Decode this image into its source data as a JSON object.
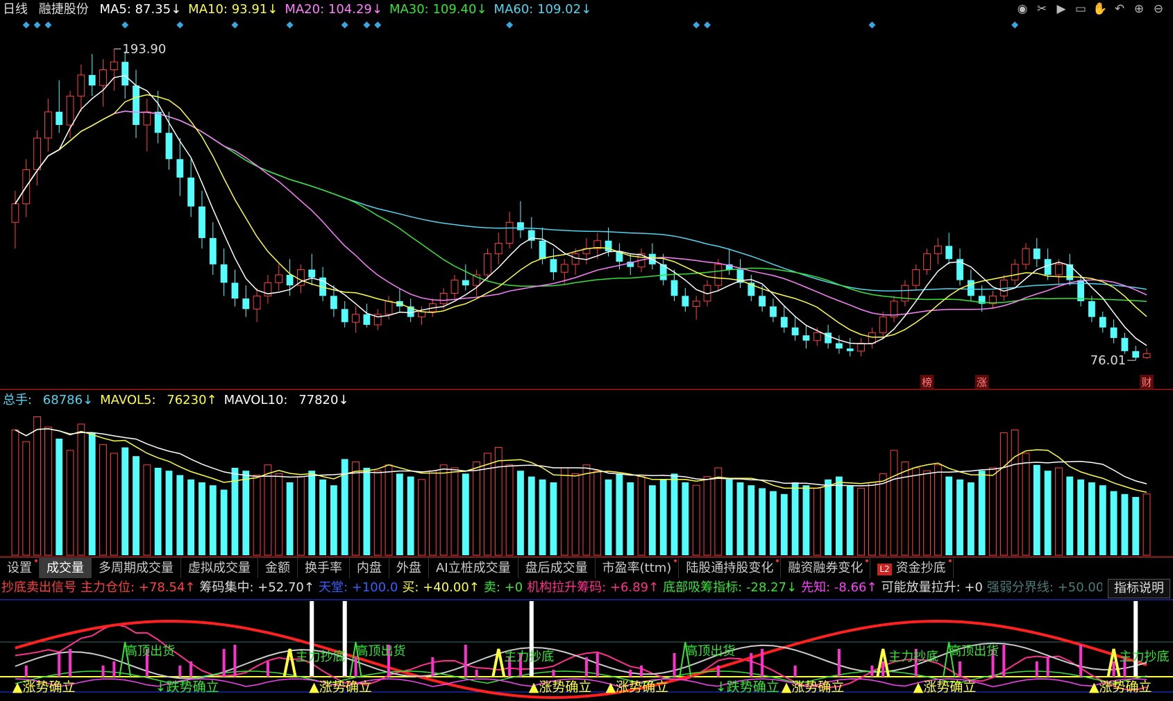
{
  "header": {
    "period": "日线",
    "stock": "融捷股份",
    "ma": [
      {
        "label": "MA5",
        "value": "87.35",
        "arrow": "↓",
        "color": "#ffffff"
      },
      {
        "label": "MA10",
        "value": "93.91",
        "arrow": "↓",
        "color": "#ffff3c"
      },
      {
        "label": "MA20",
        "value": "104.29",
        "arrow": "↓",
        "color": "#ff7fff"
      },
      {
        "label": "MA30",
        "value": "109.40",
        "arrow": "↓",
        "color": "#34e534"
      },
      {
        "label": "MA60",
        "value": "109.02",
        "arrow": "↓",
        "color": "#4fd6f0"
      }
    ]
  },
  "toolbar_icons": [
    "eye-icon",
    "scissors-icon",
    "play-icon",
    "lock-icon",
    "hand-icon",
    "undo-icon",
    "zoom-in-icon",
    "zoom-out-icon"
  ],
  "price_panel": {
    "high_label": "193.90",
    "low_label": "76.01",
    "markers": [
      "榜",
      "涨",
      "财"
    ]
  },
  "volume_header": [
    {
      "label": "总手",
      "value": "68786",
      "arrow": "↓",
      "color": "#4fd6f0"
    },
    {
      "label": "MAVOL5",
      "value": "76230",
      "arrow": "↑",
      "color": "#ffff3c"
    },
    {
      "label": "MAVOL10",
      "value": "77820",
      "arrow": "↓",
      "color": "#ffffff"
    }
  ],
  "tabs": [
    {
      "label": "设置",
      "dot": true
    },
    {
      "label": "成交量",
      "active": true
    },
    {
      "label": "多周期成交量"
    },
    {
      "label": "虚拟成交量"
    },
    {
      "label": "金额"
    },
    {
      "label": "换手率"
    },
    {
      "label": "内盘"
    },
    {
      "label": "外盘"
    },
    {
      "label": "AI立桩成交量"
    },
    {
      "label": "盘后成交量"
    },
    {
      "label": "市盈率(ttm)",
      "dot": true
    },
    {
      "label": "陆股通持股变化",
      "dot": true
    },
    {
      "label": "融资融券变化",
      "dot": true
    },
    {
      "label": "资金抄底",
      "l2": "L2",
      "dot": true
    }
  ],
  "indicator_header": [
    {
      "text": "抄底卖出信号",
      "color": "#ff4040"
    },
    {
      "text": "主力仓位:",
      "value": "+78.54",
      "arrow": "↑",
      "color": "#ff4040"
    },
    {
      "text": "筹码集中:",
      "value": "+52.70",
      "arrow": "↑",
      "color": "#dddddd"
    },
    {
      "text": "天堂:",
      "value": "+100.0",
      "color": "#3060ff"
    },
    {
      "text": "买:",
      "value": "+40.00",
      "arrow": "↑",
      "color": "#ffff3c"
    },
    {
      "text": "卖:",
      "value": "+0",
      "color": "#34e534"
    },
    {
      "text": "机构拉升筹码:",
      "value": "+6.89",
      "arrow": "↑",
      "color": "#ff3090"
    },
    {
      "text": "底部吸筹指标:",
      "value": "-28.27",
      "arrow": "↓",
      "color": "#34e534"
    },
    {
      "text": "先知:",
      "value": "-8.66",
      "arrow": "↑",
      "color": "#ff40ff"
    },
    {
      "text": "可能放量拉升:",
      "value": "+0",
      "color": "#dddddd"
    },
    {
      "text": "强弱分界线:",
      "value": "+50.00",
      "color": "#4a7a7a"
    }
  ],
  "indicator_button": "指标说明",
  "indicator_labels": {
    "top": "高顶出货",
    "bottom": "主力抄底",
    "up": "▲涨势确立",
    "down": "↓跌势确立"
  },
  "chart_data": {
    "type": "candlestick",
    "colors": {
      "up": "#ff4040",
      "down": "#54fcfc",
      "ma5": "#ffffff",
      "ma10": "#ffff3c",
      "ma20": "#ff7fff",
      "ma30": "#34e534",
      "ma60": "#4fd6f0"
    },
    "ohlc": [
      [
        128,
        140,
        118,
        135
      ],
      [
        135,
        152,
        130,
        148
      ],
      [
        148,
        163,
        142,
        160
      ],
      [
        160,
        175,
        155,
        170
      ],
      [
        170,
        182,
        162,
        165
      ],
      [
        165,
        178,
        160,
        176
      ],
      [
        176,
        188,
        170,
        184
      ],
      [
        184,
        192,
        176,
        180
      ],
      [
        180,
        190,
        172,
        186
      ],
      [
        186,
        193.9,
        178,
        189
      ],
      [
        189,
        193,
        175,
        180
      ],
      [
        180,
        186,
        160,
        165
      ],
      [
        165,
        175,
        155,
        170
      ],
      [
        170,
        178,
        158,
        162
      ],
      [
        162,
        170,
        148,
        152
      ],
      [
        152,
        160,
        138,
        145
      ],
      [
        145,
        152,
        130,
        134
      ],
      [
        134,
        140,
        118,
        122
      ],
      [
        122,
        128,
        108,
        112
      ],
      [
        112,
        118,
        100,
        105
      ],
      [
        105,
        110,
        96,
        99
      ],
      [
        99,
        104,
        92,
        95
      ],
      [
        95,
        103,
        90,
        100
      ],
      [
        100,
        108,
        97,
        105
      ],
      [
        105,
        112,
        102,
        108
      ],
      [
        108,
        114,
        100,
        104
      ],
      [
        104,
        112,
        101,
        110
      ],
      [
        110,
        116,
        104,
        107
      ],
      [
        107,
        111,
        98,
        100
      ],
      [
        100,
        104,
        92,
        95
      ],
      [
        95,
        98,
        88,
        90
      ],
      [
        90,
        96,
        86,
        93
      ],
      [
        93,
        97,
        88,
        89
      ],
      [
        89,
        95,
        87,
        93
      ],
      [
        93,
        100,
        91,
        98
      ],
      [
        98,
        103,
        94,
        96
      ],
      [
        96,
        99,
        90,
        92
      ],
      [
        92,
        96,
        89,
        94
      ],
      [
        94,
        99,
        92,
        97
      ],
      [
        97,
        103,
        95,
        101
      ],
      [
        101,
        108,
        99,
        106
      ],
      [
        106,
        112,
        102,
        104
      ],
      [
        104,
        110,
        100,
        108
      ],
      [
        108,
        118,
        106,
        116
      ],
      [
        116,
        124,
        112,
        120
      ],
      [
        120,
        132,
        118,
        128
      ],
      [
        128,
        136,
        122,
        125
      ],
      [
        125,
        130,
        118,
        121
      ],
      [
        121,
        126,
        112,
        114
      ],
      [
        114,
        118,
        106,
        109
      ],
      [
        109,
        114,
        104,
        112
      ],
      [
        112,
        118,
        108,
        116
      ],
      [
        116,
        122,
        112,
        118
      ],
      [
        118,
        124,
        114,
        121
      ],
      [
        121,
        126,
        115,
        117
      ],
      [
        117,
        120,
        110,
        113
      ],
      [
        113,
        116,
        108,
        111
      ],
      [
        111,
        118,
        109,
        116
      ],
      [
        116,
        120,
        110,
        112
      ],
      [
        112,
        116,
        104,
        106
      ],
      [
        106,
        110,
        98,
        100
      ],
      [
        100,
        103,
        94,
        96
      ],
      [
        96,
        100,
        91,
        98
      ],
      [
        98,
        106,
        96,
        104
      ],
      [
        104,
        114,
        102,
        112
      ],
      [
        112,
        118,
        108,
        110
      ],
      [
        110,
        114,
        103,
        105
      ],
      [
        105,
        108,
        98,
        100
      ],
      [
        100,
        104,
        94,
        96
      ],
      [
        96,
        99,
        90,
        92
      ],
      [
        92,
        96,
        86,
        88
      ],
      [
        88,
        92,
        83,
        85
      ],
      [
        85,
        89,
        80,
        83
      ],
      [
        83,
        88,
        81,
        86
      ],
      [
        86,
        89,
        80,
        82
      ],
      [
        82,
        85,
        78,
        80
      ],
      [
        80,
        84,
        77,
        79
      ],
      [
        79,
        84,
        77,
        82
      ],
      [
        82,
        88,
        80,
        86
      ],
      [
        86,
        94,
        84,
        92
      ],
      [
        92,
        100,
        90,
        98
      ],
      [
        98,
        106,
        96,
        104
      ],
      [
        104,
        112,
        102,
        110
      ],
      [
        110,
        118,
        108,
        116
      ],
      [
        116,
        122,
        112,
        119
      ],
      [
        119,
        124,
        112,
        114
      ],
      [
        114,
        118,
        104,
        106
      ],
      [
        106,
        110,
        98,
        100
      ],
      [
        100,
        104,
        94,
        97
      ],
      [
        97,
        102,
        95,
        100
      ],
      [
        100,
        108,
        98,
        106
      ],
      [
        106,
        114,
        104,
        112
      ],
      [
        112,
        120,
        110,
        118
      ],
      [
        118,
        122,
        111,
        114
      ],
      [
        114,
        118,
        106,
        108
      ],
      [
        108,
        114,
        104,
        112
      ],
      [
        112,
        116,
        104,
        106
      ],
      [
        106,
        108,
        96,
        98
      ],
      [
        98,
        100,
        90,
        92
      ],
      [
        92,
        94,
        86,
        88
      ],
      [
        88,
        91,
        82,
        84
      ],
      [
        84,
        86,
        78,
        79
      ],
      [
        79,
        81,
        75.5,
        76.5
      ],
      [
        76.5,
        80,
        76.01,
        78
      ]
    ],
    "volume": [
      86,
      78,
      95,
      88,
      80,
      72,
      90,
      84,
      76,
      70,
      74,
      68,
      62,
      60,
      58,
      55,
      52,
      50,
      48,
      45,
      60,
      58,
      55,
      62,
      56,
      50,
      54,
      58,
      52,
      48,
      66,
      64,
      60,
      58,
      62,
      56,
      54,
      52,
      58,
      62,
      60,
      56,
      64,
      70,
      74,
      62,
      58,
      54,
      52,
      50,
      60,
      56,
      62,
      58,
      52,
      56,
      50,
      54,
      48,
      52,
      56,
      50,
      48,
      54,
      60,
      52,
      50,
      48,
      46,
      44,
      42,
      50,
      48,
      46,
      52,
      54,
      48,
      46,
      50,
      56,
      72,
      64,
      60,
      58,
      62,
      54,
      52,
      50,
      58,
      60,
      84,
      86,
      70,
      62,
      58,
      60,
      54,
      52,
      50,
      48,
      44,
      42,
      40,
      42
    ]
  }
}
